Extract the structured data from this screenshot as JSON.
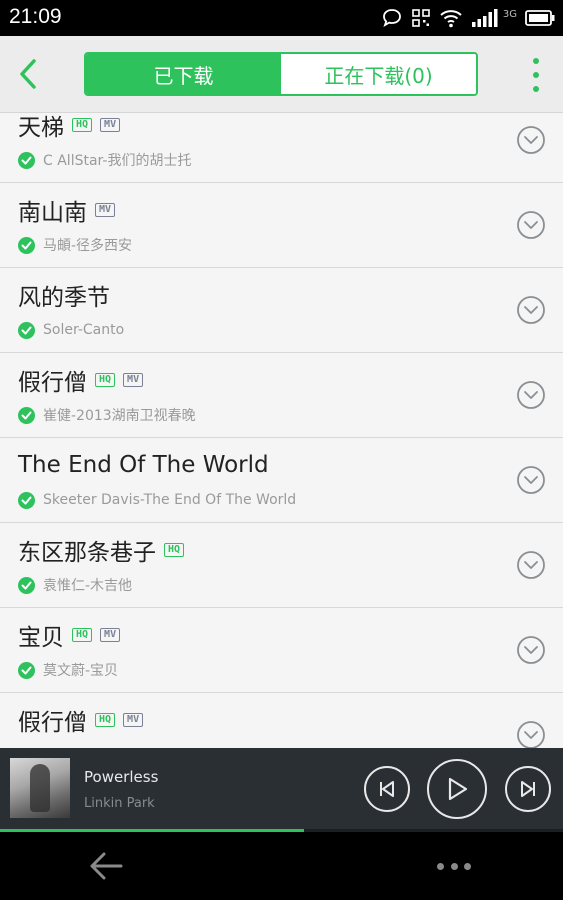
{
  "status_bar": {
    "time": "21:09",
    "network": "3G",
    "icons": [
      "chat-bubble-icon",
      "qr-icon",
      "wifi-icon",
      "signal-icon",
      "battery-icon"
    ]
  },
  "header": {
    "tabs": [
      {
        "label": "已下载",
        "active": true
      },
      {
        "label": "正在下载(0)",
        "active": false
      }
    ],
    "back_icon": "chevron-left-icon",
    "menu_icon": "more-vertical-icon"
  },
  "songs": [
    {
      "title": "天梯",
      "hq": "HQ",
      "mv": "MV",
      "artist": "C AllStar-我们的胡士托"
    },
    {
      "title": "南山南",
      "hq": "",
      "mv": "MV",
      "artist": "马頔-径多西安"
    },
    {
      "title": "风的季节",
      "hq": "",
      "mv": "",
      "artist": "Soler-Canto"
    },
    {
      "title": "假行僧",
      "hq": "HQ",
      "mv": "MV",
      "artist": "崔健-2013湖南卫视春晚"
    },
    {
      "title": "The End Of The World",
      "hq": "",
      "mv": "",
      "artist": "Skeeter Davis-The End Of The World"
    },
    {
      "title": "东区那条巷子",
      "hq": "HQ",
      "mv": "",
      "artist": "袁惟仁-木吉他"
    },
    {
      "title": "宝贝",
      "hq": "HQ",
      "mv": "MV",
      "artist": "莫文蔚-宝贝"
    },
    {
      "title": "假行僧",
      "hq": "HQ",
      "mv": "MV",
      "artist": ""
    }
  ],
  "player": {
    "title": "Powerless",
    "artist": "Linkin Park",
    "progress": 0.54
  },
  "colors": {
    "accent": "#2ec25d",
    "mv_badge": "#7a8196",
    "player_bg": "#2a2f33",
    "list_bg": "#f4f5f4"
  }
}
